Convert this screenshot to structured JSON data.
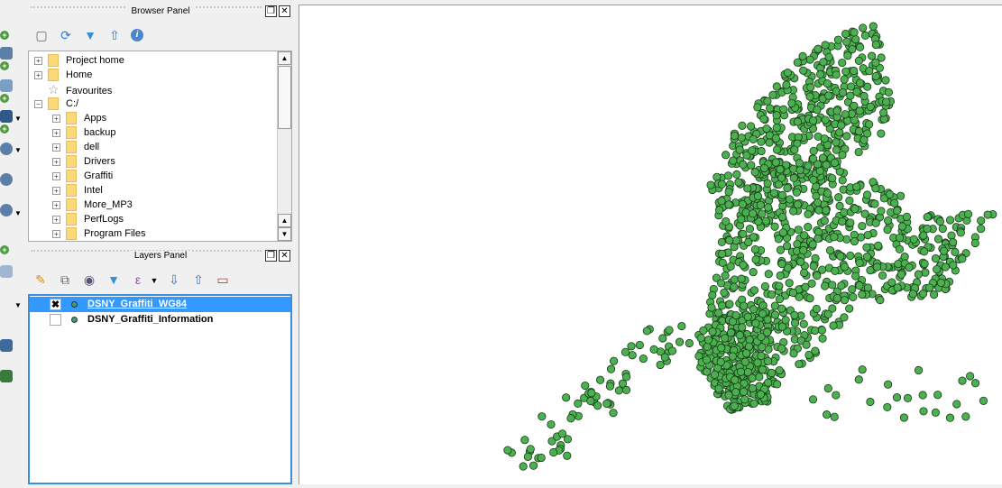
{
  "browser_panel": {
    "title": "Browser Panel",
    "toolbar": [
      "add-layer-icon",
      "refresh-icon",
      "filter-icon",
      "collapse-icon",
      "info-icon"
    ],
    "items": [
      {
        "label": "Project home",
        "level": 0,
        "expand": "+",
        "icon": "folder"
      },
      {
        "label": "Home",
        "level": 0,
        "expand": "+",
        "icon": "folder"
      },
      {
        "label": "Favourites",
        "level": 0,
        "expand": "",
        "icon": "star"
      },
      {
        "label": "C:/",
        "level": 0,
        "expand": "-",
        "icon": "folder"
      },
      {
        "label": "Apps",
        "level": 1,
        "expand": "+",
        "icon": "folder"
      },
      {
        "label": "backup",
        "level": 1,
        "expand": "+",
        "icon": "folder"
      },
      {
        "label": "dell",
        "level": 1,
        "expand": "+",
        "icon": "folder"
      },
      {
        "label": "Drivers",
        "level": 1,
        "expand": "+",
        "icon": "folder"
      },
      {
        "label": "Graffiti",
        "level": 1,
        "expand": "+",
        "icon": "folder"
      },
      {
        "label": "Intel",
        "level": 1,
        "expand": "+",
        "icon": "folder"
      },
      {
        "label": "More_MP3",
        "level": 1,
        "expand": "+",
        "icon": "folder"
      },
      {
        "label": "PerfLogs",
        "level": 1,
        "expand": "+",
        "icon": "folder"
      },
      {
        "label": "Program Files",
        "level": 1,
        "expand": "+",
        "icon": "folder"
      }
    ]
  },
  "layers_panel": {
    "title": "Layers Panel",
    "toolbar": [
      "style-icon",
      "add-group-icon",
      "visibility-icon",
      "filter-icon",
      "expression-icon",
      "expand-icon",
      "collapse-icon",
      "remove-layer-icon"
    ],
    "layers": [
      {
        "name": "DSNY_Graffiti_WG84",
        "checked": true,
        "selected": true
      },
      {
        "name": "DSNY_Graffiti_Information",
        "checked": false,
        "selected": false
      }
    ]
  },
  "colors": {
    "point_fill": "#4caf50",
    "point_stroke": "#1a3a1a",
    "selection": "#3399ff"
  }
}
